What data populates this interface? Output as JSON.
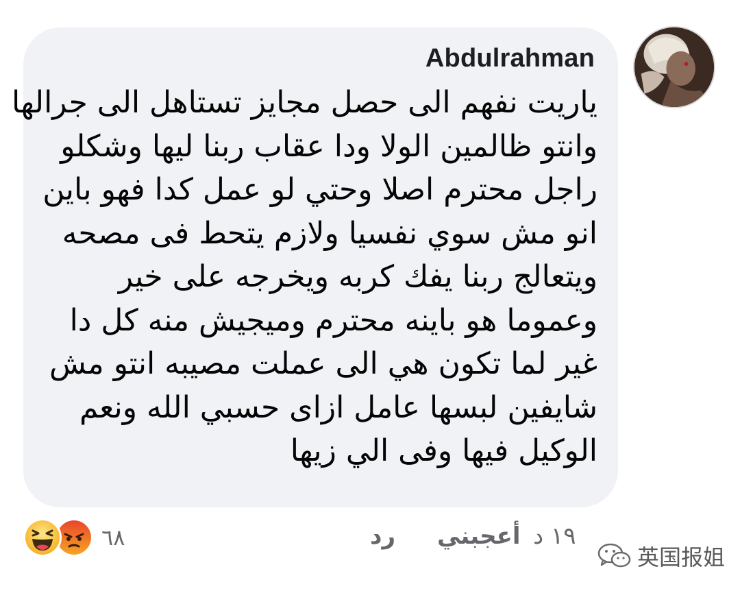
{
  "comment": {
    "author": "Abdulrahman",
    "lines": [
      "ياريت نفهم الى حصل مجايز تستاهل الى جرالها",
      "وانتو ظالمين الولا ودا عقاب ربنا ليها  وشكلو",
      "راجل محترم اصلا وحتي لو عمل كدا فهو باين",
      "انو مش سوي نفسيا  ولازم يتحط فى مصحه",
      "ويتعالج ربنا يفك كربه ويخرجه على خير",
      "وعموما هو باينه محترم وميجيش منه كل دا",
      "غير لما تكون هي الى عملت مصيبه  انتو مش",
      "شايفين لبسها عامل ازاى حسبي الله ونعم",
      "الوكيل فيها وفى الي زيها"
    ]
  },
  "actions": {
    "time": "١٩ د",
    "like_label": "أعجبني",
    "reply_label": "رد"
  },
  "reactions": {
    "icons": [
      "haha-reaction-icon",
      "angry-reaction-icon"
    ],
    "count": "٦٨"
  },
  "watermark": {
    "text": "英国报姐",
    "icon": "wechat-logo-icon"
  },
  "colors": {
    "bubble_bg": "#f0f2f5",
    "text": "#050505",
    "meta": "#65676b",
    "haha": "#f7b125",
    "angry": "#e9710f"
  }
}
